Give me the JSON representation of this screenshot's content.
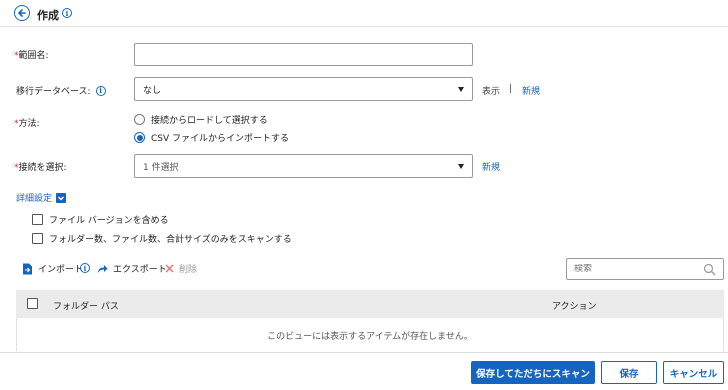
{
  "header": {
    "title": "作成"
  },
  "form": {
    "scope_name": {
      "label": "範囲名:",
      "value": ""
    },
    "migration_db": {
      "label": "移行データベース:",
      "selected": "なし",
      "view_link": "表示",
      "separator": "|",
      "new_link": "新規"
    },
    "method": {
      "label": "方法:",
      "options": [
        "接続からロードして選択する",
        "CSV ファイルからインポートする"
      ],
      "selected_index": 1
    },
    "connection": {
      "label": "接続を選択:",
      "selected": "1 件選択",
      "new_link": "新規"
    },
    "advanced": {
      "label": "詳細設定",
      "checkboxes": [
        "ファイル バージョンを含める",
        "フォルダー数、ファイル数、合計サイズのみをスキャンする"
      ]
    }
  },
  "toolbar": {
    "import_label": "インポート",
    "export_label": "エクスポート",
    "delete_label": "削除"
  },
  "search": {
    "placeholder": "検索"
  },
  "table": {
    "columns": [
      "フォルダー パス",
      "アクション"
    ],
    "empty_message": "このビューには表示するアイテムが存在しません。"
  },
  "footer": {
    "save_scan_label": "保存してただちにスキャン",
    "save_label": "保存",
    "cancel_label": "キャンセル"
  },
  "colors": {
    "accent": "#1565c0",
    "required": "#d32f2f"
  }
}
